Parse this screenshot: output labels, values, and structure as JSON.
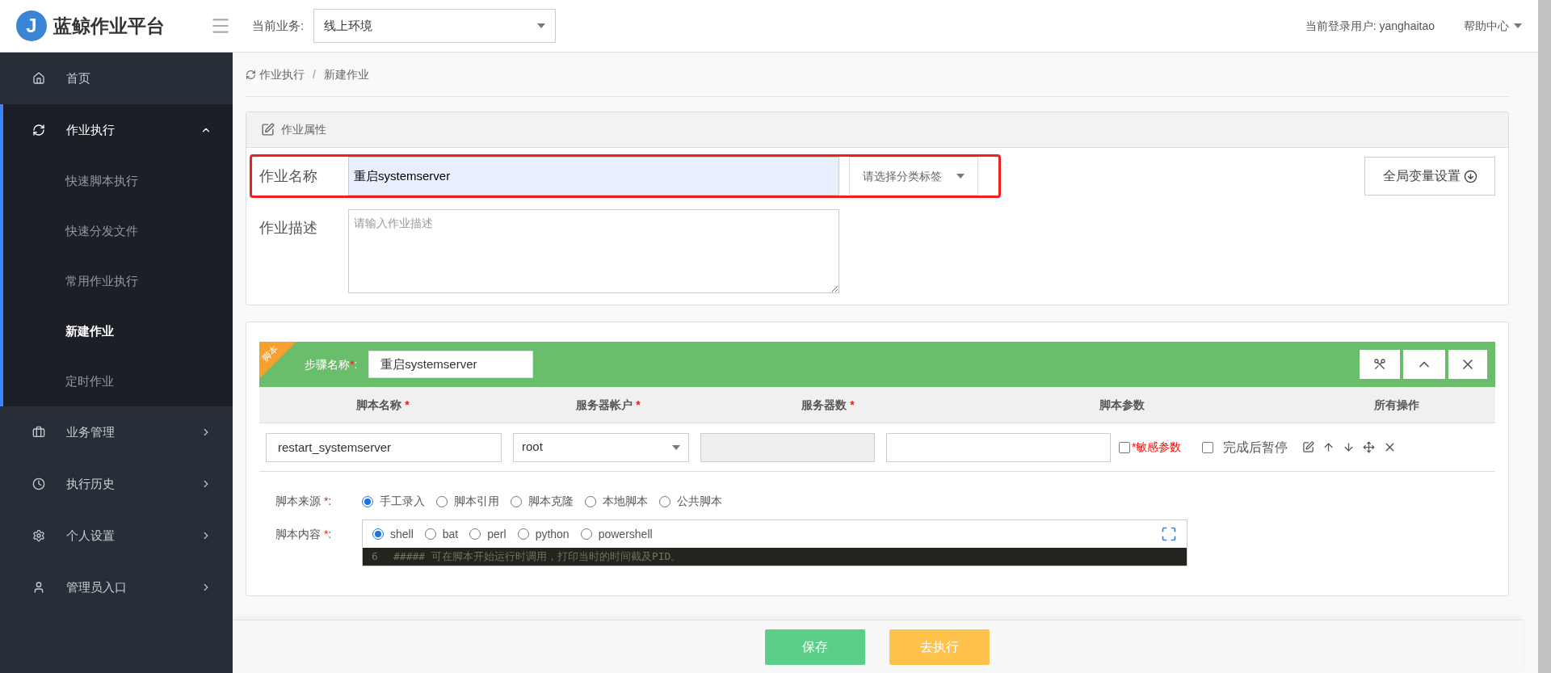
{
  "header": {
    "logo_letter": "J",
    "app_name": "蓝鲸作业平台",
    "business_label": "当前业务:",
    "business_value": "线上环境",
    "user_label": "当前登录用户: yanghaitao",
    "help": "帮助中心"
  },
  "sidebar": {
    "items": [
      {
        "label": "首页",
        "expanded": false
      },
      {
        "label": "作业执行",
        "expanded": true,
        "children": [
          {
            "label": "快速脚本执行",
            "selected": false
          },
          {
            "label": "快速分发文件",
            "selected": false
          },
          {
            "label": "常用作业执行",
            "selected": false
          },
          {
            "label": "新建作业",
            "selected": true
          },
          {
            "label": "定时作业",
            "selected": false
          }
        ]
      },
      {
        "label": "业务管理",
        "expanded": false
      },
      {
        "label": "执行历史",
        "expanded": false
      },
      {
        "label": "个人设置",
        "expanded": false
      },
      {
        "label": "管理员入口",
        "expanded": false
      }
    ]
  },
  "breadcrumb": [
    "作业执行",
    "新建作业"
  ],
  "breadcrumb_separator": "/",
  "job_properties": {
    "title": "作业属性",
    "name_label": "作业名称",
    "name_value": "重启systemserver",
    "tag_placeholder": "请选择分类标签",
    "global_vars_button": "全局变量设置",
    "desc_label": "作业描述",
    "desc_placeholder": "请输入作业描述",
    "highlighted": true
  },
  "step": {
    "badge": "脚本",
    "name_label": "步骤名称",
    "required_mark": "*",
    "colon": ":",
    "name_value": "重启systemserver",
    "columns": [
      {
        "label": "脚本名称",
        "required": true
      },
      {
        "label": "服务器帐户",
        "required": true
      },
      {
        "label": "服务器数",
        "required": true
      },
      {
        "label": "脚本参数",
        "required": false
      },
      {
        "label": "所有操作",
        "required": false
      }
    ],
    "row": {
      "script_name": "restart_systemserver",
      "account": "root",
      "sensitive_label": "*敏感参数",
      "sensitive_checked": false,
      "pause_label": "完成后暂停",
      "pause_checked": false
    },
    "source_label": "脚本来源",
    "source_options": [
      {
        "label": "手工录入",
        "selected": true
      },
      {
        "label": "脚本引用",
        "selected": false
      },
      {
        "label": "脚本克隆",
        "selected": false
      },
      {
        "label": "本地脚本",
        "selected": false
      },
      {
        "label": "公共脚本",
        "selected": false
      }
    ],
    "content_label": "脚本内容",
    "languages": [
      {
        "label": "shell",
        "selected": true
      },
      {
        "label": "bat",
        "selected": false
      },
      {
        "label": "perl",
        "selected": false
      },
      {
        "label": "python",
        "selected": false
      },
      {
        "label": "powershell",
        "selected": false
      }
    ],
    "code_line_number": "6",
    "code_line": "##### 可在脚本开始运行时调用，打印当时的时间截及PID。"
  },
  "footer": {
    "save": "保存",
    "execute": "去执行"
  }
}
